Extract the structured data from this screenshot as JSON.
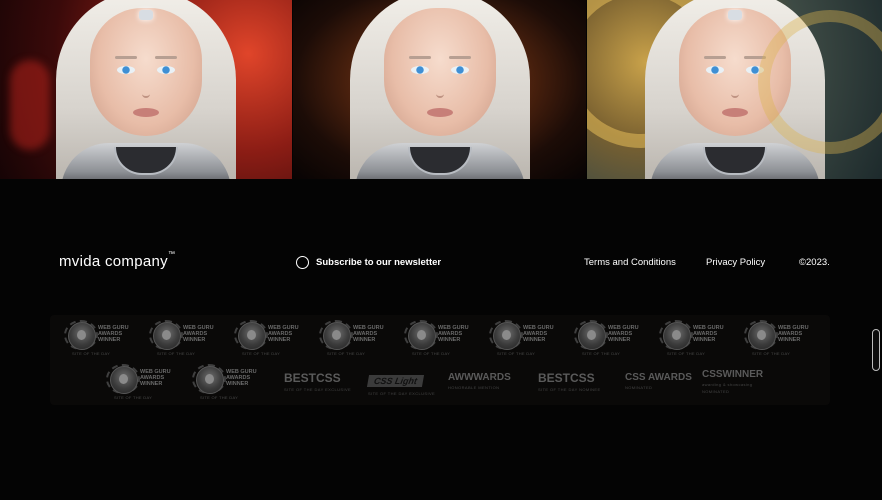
{
  "footer": {
    "brand": "mvida company",
    "brand_tm": "™",
    "newsletter_label": "Subscribe to our newsletter",
    "terms_label": "Terms and Conditions",
    "privacy_label": "Privacy Policy",
    "copyright": "©2023."
  },
  "awards": {
    "webguru_title": "WEB GURU AWARDS WINNER",
    "webguru_sub": "SITE OF THE DAY",
    "bestcss_title": "BESTCSS",
    "bestcss_sub": "SITE OF THE DAY EXCLUSIVE",
    "csslight_title": "CSS Light",
    "csslight_sub": "SITE OF THE DAY EXCLUSIVE",
    "awwwards_title": "AWWWARDS",
    "awwwards_sub": "HONORABLE MENTION",
    "bestcss2_title": "BESTCSS",
    "bestcss2_sub": "SITE OF THE DAY NOMINEE",
    "cssawards_title": "CSS AWARDS",
    "cssawards_sub": "NOMINATED",
    "csswinner_title": "CSSWINNER",
    "csswinner_tag": "awarding & showcasing",
    "csswinner_sub": "NOMINATED"
  },
  "hero": {
    "panel_1_icon": "portrait-red-background",
    "panel_2_icon": "portrait-amber-background",
    "panel_3_icon": "portrait-gold-background"
  },
  "colors": {
    "background": "#040404",
    "text": "#ffffff",
    "award_gray": "#5a5a5a"
  }
}
